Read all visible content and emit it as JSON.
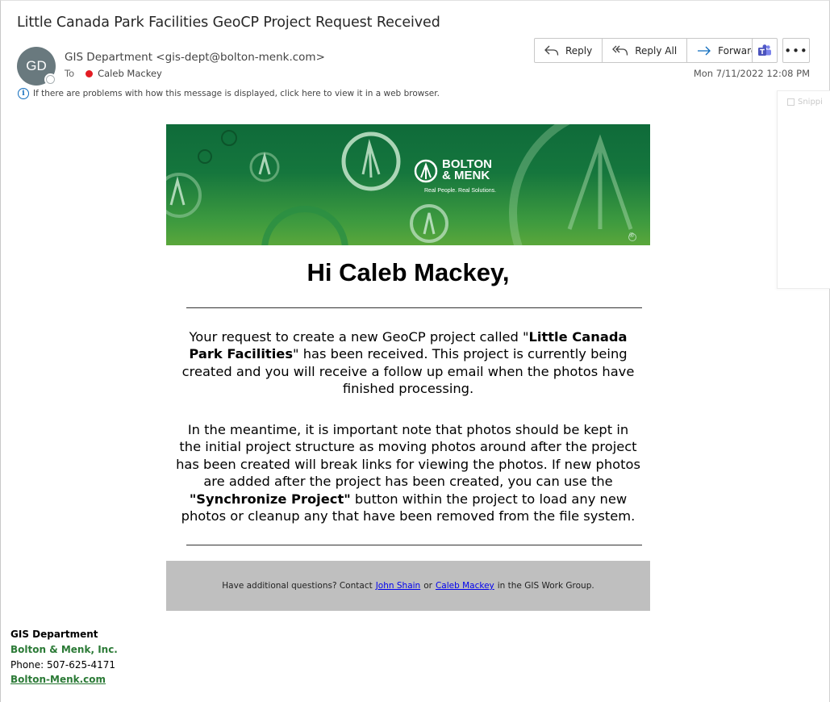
{
  "email": {
    "subject": "Little Canada Park Facilities GeoCP Project Request Received",
    "avatar_initials": "GD",
    "sender": "GIS Department <gis-dept@bolton-menk.com>",
    "to_label": "To",
    "recipient": "Caleb Mackey",
    "date": "Mon 7/11/2022 12:08 PM",
    "info_notice": "If there are problems with how this message is displayed, click here to view it in a web browser."
  },
  "toolbar": {
    "reply_label": "Reply",
    "reply_all_label": "Reply All",
    "forward_label": "Forward",
    "more_label": "•••"
  },
  "side_pane": {
    "label": "Snippi"
  },
  "banner": {
    "logo_line1": "BOLTON",
    "logo_line2": "& MENK",
    "tagline": "Real People. Real Solutions.",
    "registered": "®"
  },
  "body": {
    "greeting": "Hi Caleb Mackey,",
    "p1_a": "Your request to create a new GeoCP project called \"",
    "p1_bold": "Little Canada Park Facilities",
    "p1_b": "\" has been received. This project is currently being created and you will receive a follow up email when the photos have finished processing.",
    "p2_a": "In the meantime, it is important note that photos should be kept in the initial project structure as moving photos around after the project has been created will break links for viewing the photos. If new photos are added after the project has been created, you can use the ",
    "p2_bold": "\"Synchronize Project\"",
    "p2_b": " button within the project to load any new photos or cleanup any that have been removed from the file system."
  },
  "footer": {
    "text_a": "Have additional questions? Contact",
    "link1": "John Shain",
    "text_b": "or",
    "link2": "Caleb Mackey",
    "text_c": "in the GIS Work Group."
  },
  "signature": {
    "name": "GIS Department",
    "company": "Bolton & Menk, Inc.",
    "phone": "Phone: 507-625-4171",
    "website": "Bolton-Menk.com"
  },
  "colors": {
    "brand_green": "#15763d",
    "link_blue": "#0000ee",
    "presence_red": "#e31c23",
    "footer_gray": "#bfbfbf"
  }
}
